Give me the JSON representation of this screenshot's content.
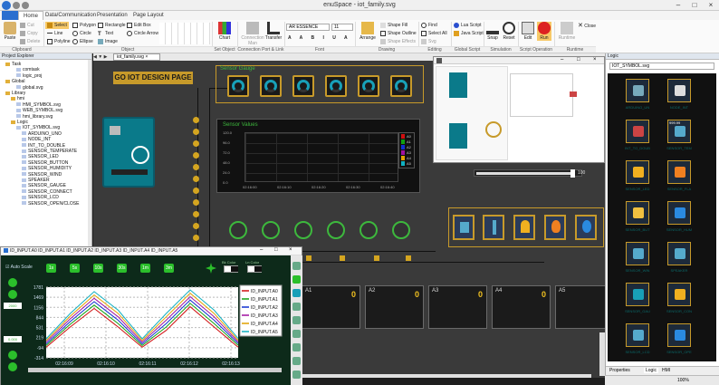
{
  "app": {
    "title": "enuSpace - iot_family.svg",
    "tabs": [
      "Home",
      "Data/Communication",
      "Presentation",
      "Page Layout"
    ]
  },
  "ribbon": {
    "paste": "Paste",
    "cut": "Cut",
    "copy": "Copy",
    "delete": "Delete",
    "select": "Select",
    "line": "Line",
    "polyline": "Polyline",
    "polygon": "Polygon",
    "circle": "Circle",
    "ellipse": "Ellipse",
    "rectangle": "Rectangle",
    "text": "Text",
    "image": "Image",
    "edit_box": "Edit Box",
    "circle_arrow": "Circle Arrow",
    "chart": "Chart",
    "connection": "Connection\nMan",
    "transfer": "Transfer",
    "font_name": "AR ESSENCE",
    "font_size": "11",
    "arrange": "Arrange",
    "shape_fill": "Shape Fill",
    "shape_outline": "Shape Outline",
    "shape_effects": "Shape Effects",
    "find": "Find",
    "select_all": "Select All",
    "svg": "Svg",
    "lua_script": "Lua Script",
    "java_script": "Java Script",
    "edit": "Edit",
    "snap": "Snap",
    "reset": "Reset",
    "run": "Run",
    "runtime": "Runtime",
    "close": "Close",
    "groups": [
      "Clipboard",
      "Object",
      "Set Object",
      "Connection Port & Link",
      "Font",
      "Drawing",
      "Editing",
      "Global Script",
      "Simulation",
      "Script Operation",
      "Runtime"
    ]
  },
  "explorer": {
    "header": "Project Explorer",
    "items": [
      {
        "label": "Task",
        "indent": 1
      },
      {
        "label": "comtask",
        "indent": 3
      },
      {
        "label": "logic_proj",
        "indent": 3
      },
      {
        "label": "Global",
        "indent": 1
      },
      {
        "label": "global.svg",
        "indent": 3
      },
      {
        "label": "Library",
        "indent": 1
      },
      {
        "label": "hmi",
        "indent": 2
      },
      {
        "label": "HMI_SYMBOL.svg",
        "indent": 3
      },
      {
        "label": "WEB_SYMBOL.svg",
        "indent": 3
      },
      {
        "label": "hmi_library.svg",
        "indent": 3
      },
      {
        "label": "Logic",
        "indent": 2
      },
      {
        "label": "IOT_SYMBOL.svg",
        "indent": 3
      },
      {
        "label": "ARDUINO_UNO",
        "indent": 4
      },
      {
        "label": "NODE_INT",
        "indent": 4
      },
      {
        "label": "INT_TO_DOUBLE",
        "indent": 4
      },
      {
        "label": "SENSOR_TEMPERATE",
        "indent": 4
      },
      {
        "label": "SENSOR_LED",
        "indent": 4
      },
      {
        "label": "SENSOR_BUTTON",
        "indent": 4
      },
      {
        "label": "SENSOR_HUMIDITY",
        "indent": 4
      },
      {
        "label": "SENSOR_WIND",
        "indent": 4
      },
      {
        "label": "SPEAKER",
        "indent": 4
      },
      {
        "label": "SENSOR_GAUGE",
        "indent": 4
      },
      {
        "label": "SENSOR_CONNECT",
        "indent": 4
      },
      {
        "label": "SENSOR_LCD",
        "indent": 4
      },
      {
        "label": "SENSOR_OPEN/CLOSE",
        "indent": 4
      }
    ]
  },
  "doc_tab": "iot_family.svg",
  "canvas": {
    "banner": "GO IOT DESIGN PAGE",
    "gauge_title": "Sensor Gauge",
    "values_title": "Sensor Values",
    "legend": [
      "A0",
      "A1",
      "A2",
      "A3",
      "A4",
      "A5"
    ],
    "yticks": [
      "120.0",
      "96.0",
      "72.0",
      "48.0",
      "24.0",
      "0.0"
    ],
    "xticks": [
      "02:16:00",
      "02:16:10",
      "02:16:20",
      "02:16:30",
      "02:16:40"
    ],
    "lcds": [
      {
        "label": "A1",
        "value": "0"
      },
      {
        "label": "A2",
        "value": "0"
      },
      {
        "label": "A3",
        "value": "0"
      },
      {
        "label": "A4",
        "value": "0"
      },
      {
        "label": "A5",
        "value": "0"
      },
      {
        "label": "",
        "value": "0"
      }
    ]
  },
  "preview": {
    "slider_value": "100"
  },
  "logic": {
    "header": "Logic",
    "file": "IOT_SYMBOL.svg",
    "items": [
      {
        "label": "ARDUINO_UN",
        "icon": "arduino-icon"
      },
      {
        "label": "NODE_INT",
        "icon": "node-icon"
      },
      {
        "label": "INT_TO_DOUB",
        "icon": "convert-icon"
      },
      {
        "label": "SENSOR_TEM",
        "icon": "thermometer-icon"
      },
      {
        "label": "SENSOR_LED",
        "icon": "led-icon"
      },
      {
        "label": "SENSOR_FLA",
        "icon": "flame-icon"
      },
      {
        "label": "SENSOR_BUT",
        "icon": "button-icon"
      },
      {
        "label": "SENSOR_HUM",
        "icon": "droplet-icon"
      },
      {
        "label": "SENSOR_WIN",
        "icon": "wind-icon"
      },
      {
        "label": "SPEAKER",
        "icon": "speaker-icon"
      },
      {
        "label": "SENSOR_GAU",
        "icon": "gauge-icon"
      },
      {
        "label": "SENSOR_CON",
        "icon": "connect-icon"
      },
      {
        "label": "SENSOR_LCD",
        "icon": "lcd-icon"
      },
      {
        "label": "SENSOR_OPE",
        "icon": "lock-icon"
      }
    ],
    "node_val": "999.99",
    "tabs": [
      "Properties",
      "Logic",
      "HMI"
    ]
  },
  "chartwin": {
    "title": "ID_INPUT.A0 ID_INPUT.A1 ID_INPUT.A2 ID_INPUT.A3 ID_INPUT.A4 ID_INPUT.A5",
    "auto_scale": "Auto Scale",
    "buttons": [
      "1s",
      "5s",
      "10s",
      "30s",
      "1m",
      "3m"
    ],
    "bk_color": "Bk Color",
    "ln_color": "Ln Color",
    "side_top": "2000",
    "side_bottom": "0.000"
  },
  "chart_data": {
    "type": "line",
    "x": [
      "02:16:09",
      "02:16:10",
      "02:16:11",
      "02:16:12",
      "02:16:13"
    ],
    "ylim": [
      -314,
      1781
    ],
    "yticks": [
      "1781",
      "1469",
      "1156",
      "844",
      "531",
      "219",
      "-94",
      "-314"
    ],
    "series": [
      {
        "name": "ID_INPUT.A0",
        "color": "#d01010",
        "values": [
          0,
          600,
          1150,
          600,
          0,
          500,
          1200,
          600,
          0
        ]
      },
      {
        "name": "ID_INPUT.A1",
        "color": "#10a010",
        "values": [
          50,
          680,
          1250,
          700,
          50,
          600,
          1300,
          700,
          60
        ]
      },
      {
        "name": "ID_INPUT.A2",
        "color": "#1030d0",
        "values": [
          100,
          760,
          1350,
          800,
          100,
          700,
          1400,
          800,
          110
        ]
      },
      {
        "name": "ID_INPUT.A3",
        "color": "#a010a0",
        "values": [
          150,
          840,
          1450,
          900,
          150,
          800,
          1500,
          900,
          160
        ]
      },
      {
        "name": "ID_INPUT.A4",
        "color": "#e0a000",
        "values": [
          200,
          920,
          1550,
          1000,
          200,
          900,
          1600,
          1000,
          210
        ]
      },
      {
        "name": "ID_INPUT.A5",
        "color": "#10b0c0",
        "values": [
          250,
          1000,
          1650,
          1100,
          250,
          1000,
          1700,
          1100,
          260
        ]
      }
    ]
  },
  "status": {
    "zoom": "100%"
  }
}
